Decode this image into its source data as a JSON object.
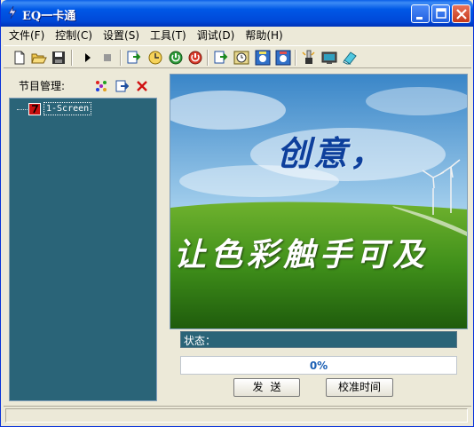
{
  "window": {
    "title": "EQ一卡通"
  },
  "menu": [
    {
      "label": "文件(F)"
    },
    {
      "label": "控制(C)"
    },
    {
      "label": "设置(S)"
    },
    {
      "label": "工具(T)"
    },
    {
      "label": "调试(D)"
    },
    {
      "label": "帮助(H)"
    }
  ],
  "toolbar": {
    "icons": [
      "new-file-icon",
      "open-folder-icon",
      "save-icon",
      "play-icon",
      "stop-icon",
      "send-to-screen-icon",
      "clock-icon",
      "power-on-icon",
      "power-off-icon",
      "upload-icon",
      "timer-icon",
      "brightness-icon",
      "brightness-schedule-icon",
      "brush-icon",
      "monitor-icon",
      "eraser-icon"
    ]
  },
  "left_panel": {
    "header": "节目管理:",
    "tree": {
      "nodes": [
        {
          "label": "1-Screen"
        }
      ]
    }
  },
  "preview": {
    "slogan_line1": "创意，",
    "slogan_line2": "让色彩触手可及"
  },
  "status": {
    "label": "状态："
  },
  "progress": {
    "value": 0,
    "text": "0%"
  },
  "buttons": {
    "send": "发送",
    "calibrate_time": "校准时间"
  },
  "colors": {
    "titlebar": "#0058e6",
    "panel_bg": "#2a6478",
    "window_bg": "#ece9d8",
    "progress_text": "#1a5fb4"
  }
}
